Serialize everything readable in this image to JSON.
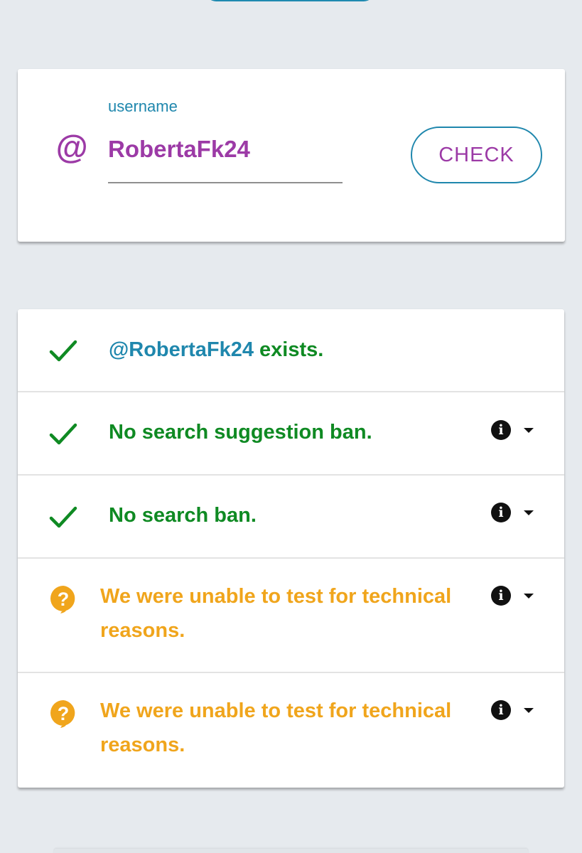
{
  "form": {
    "label": "username",
    "value": "RobertaFk24",
    "prefix_icon": "at-sign-icon",
    "button_label": "CHECK"
  },
  "results": [
    {
      "status": "ok",
      "icon": "check-icon",
      "username": "@RobertaFk24",
      "text": " exists.",
      "has_info": false
    },
    {
      "status": "ok",
      "icon": "check-icon",
      "text": "No search suggestion ban.",
      "has_info": true
    },
    {
      "status": "ok",
      "icon": "check-icon",
      "text": "No search ban.",
      "has_info": true
    },
    {
      "status": "unknown",
      "icon": "question-bubble-icon",
      "text_line1": "We were unable to test for technical",
      "text_line2": "reasons.",
      "has_info": true
    },
    {
      "status": "unknown",
      "icon": "question-bubble-icon",
      "text_line1": "We were unable to test for technical",
      "text_line2": "reasons.",
      "has_info": true
    }
  ],
  "colors": {
    "accent_blue": "#1f87ad",
    "accent_purple": "#9c3aa6",
    "ok_green": "#0f8a23",
    "warn_orange": "#f0a51c",
    "background": "#e6eaee"
  }
}
